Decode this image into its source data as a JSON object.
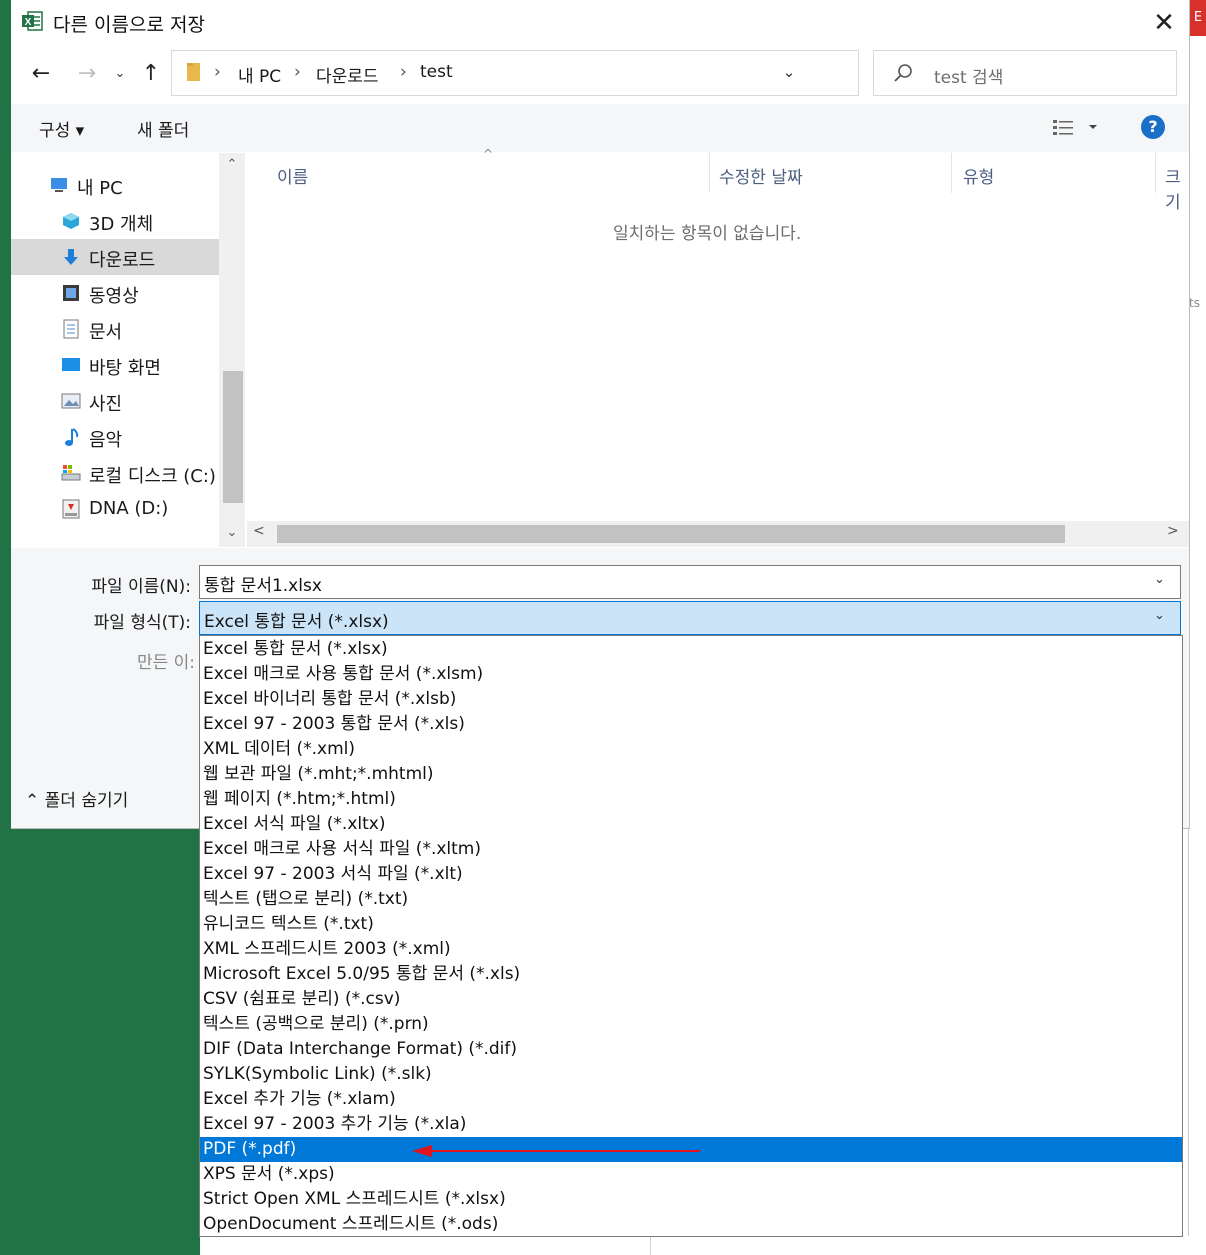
{
  "dialog": {
    "title": "다른 이름으로 저장",
    "close_icon": "✕"
  },
  "nav": {
    "back_icon": "←",
    "forward_icon": "→",
    "recent_icon": "⌄",
    "up_icon": "↑",
    "breadcrumb": [
      "내 PC",
      "다운로드",
      "test"
    ],
    "breadcrumb_sep": "›",
    "address_dropdown_icon": "⌄",
    "refresh_icon": "↻",
    "search_placeholder": "test 검색"
  },
  "toolbar": {
    "organize_label": "구성 ▾",
    "new_folder_label": "새 폴더",
    "help_label": "?"
  },
  "sidebar": {
    "items": [
      {
        "label": "내 PC",
        "icon": "computer-icon"
      },
      {
        "label": "3D 개체",
        "icon": "cube-icon"
      },
      {
        "label": "다운로드",
        "icon": "download-icon",
        "selected": true
      },
      {
        "label": "동영상",
        "icon": "video-icon"
      },
      {
        "label": "문서",
        "icon": "document-icon"
      },
      {
        "label": "바탕 화면",
        "icon": "desktop-icon"
      },
      {
        "label": "사진",
        "icon": "picture-icon"
      },
      {
        "label": "음악",
        "icon": "music-icon"
      },
      {
        "label": "로컬 디스크 (C:)",
        "icon": "drive-icon"
      },
      {
        "label": "DNA (D:)",
        "icon": "usb-drive-icon"
      }
    ],
    "scroll_up": "⌃",
    "scroll_down": "⌄"
  },
  "file_list": {
    "columns": [
      "이름",
      "수정한 날짜",
      "유형",
      "크기"
    ],
    "sort_arrow": "^",
    "empty_message": "일치하는 항목이 없습니다.",
    "scroll_left": "<",
    "scroll_right": ">"
  },
  "form": {
    "filename_label": "파일 이름(N):",
    "filename_value": "통합 문서1.xlsx",
    "filetype_label": "파일 형식(T):",
    "filetype_value": "Excel 통합 문서 (*.xlsx)",
    "author_label": "만든 이:",
    "dropdown_icon": "⌄",
    "hide_folders_label": "⌃  폴더 숨기기"
  },
  "file_types": {
    "selected_index": 20,
    "options": [
      "Excel 통합 문서 (*.xlsx)",
      "Excel 매크로 사용 통합 문서 (*.xlsm)",
      "Excel 바이너리 통합 문서 (*.xlsb)",
      "Excel 97 - 2003 통합 문서 (*.xls)",
      "XML 데이터 (*.xml)",
      "웹 보관 파일 (*.mht;*.mhtml)",
      "웹 페이지 (*.htm;*.html)",
      "Excel 서식 파일 (*.xltx)",
      "Excel 매크로 사용 서식 파일 (*.xltm)",
      "Excel 97 - 2003 서식 파일 (*.xlt)",
      "텍스트 (탭으로 분리) (*.txt)",
      "유니코드 텍스트 (*.txt)",
      "XML 스프레드시트 2003 (*.xml)",
      "Microsoft Excel 5.0/95 통합 문서 (*.xls)",
      "CSV (쉼표로 분리) (*.csv)",
      "텍스트 (공백으로 분리) (*.prn)",
      "DIF (Data Interchange Format) (*.dif)",
      "SYLK(Symbolic Link) (*.slk)",
      "Excel 추가 기능 (*.xlam)",
      "Excel 97 - 2003 추가 기능 (*.xla)",
      "PDF (*.pdf)",
      "XPS 문서 (*.xps)",
      "Strict Open XML 스프레드시트 (*.xlsx)",
      "OpenDocument 스프레드시트 (*.ods)"
    ]
  },
  "colors": {
    "excel_green": "#217346",
    "selection_blue": "#0078d7",
    "annotation_red": "#e0141e"
  }
}
